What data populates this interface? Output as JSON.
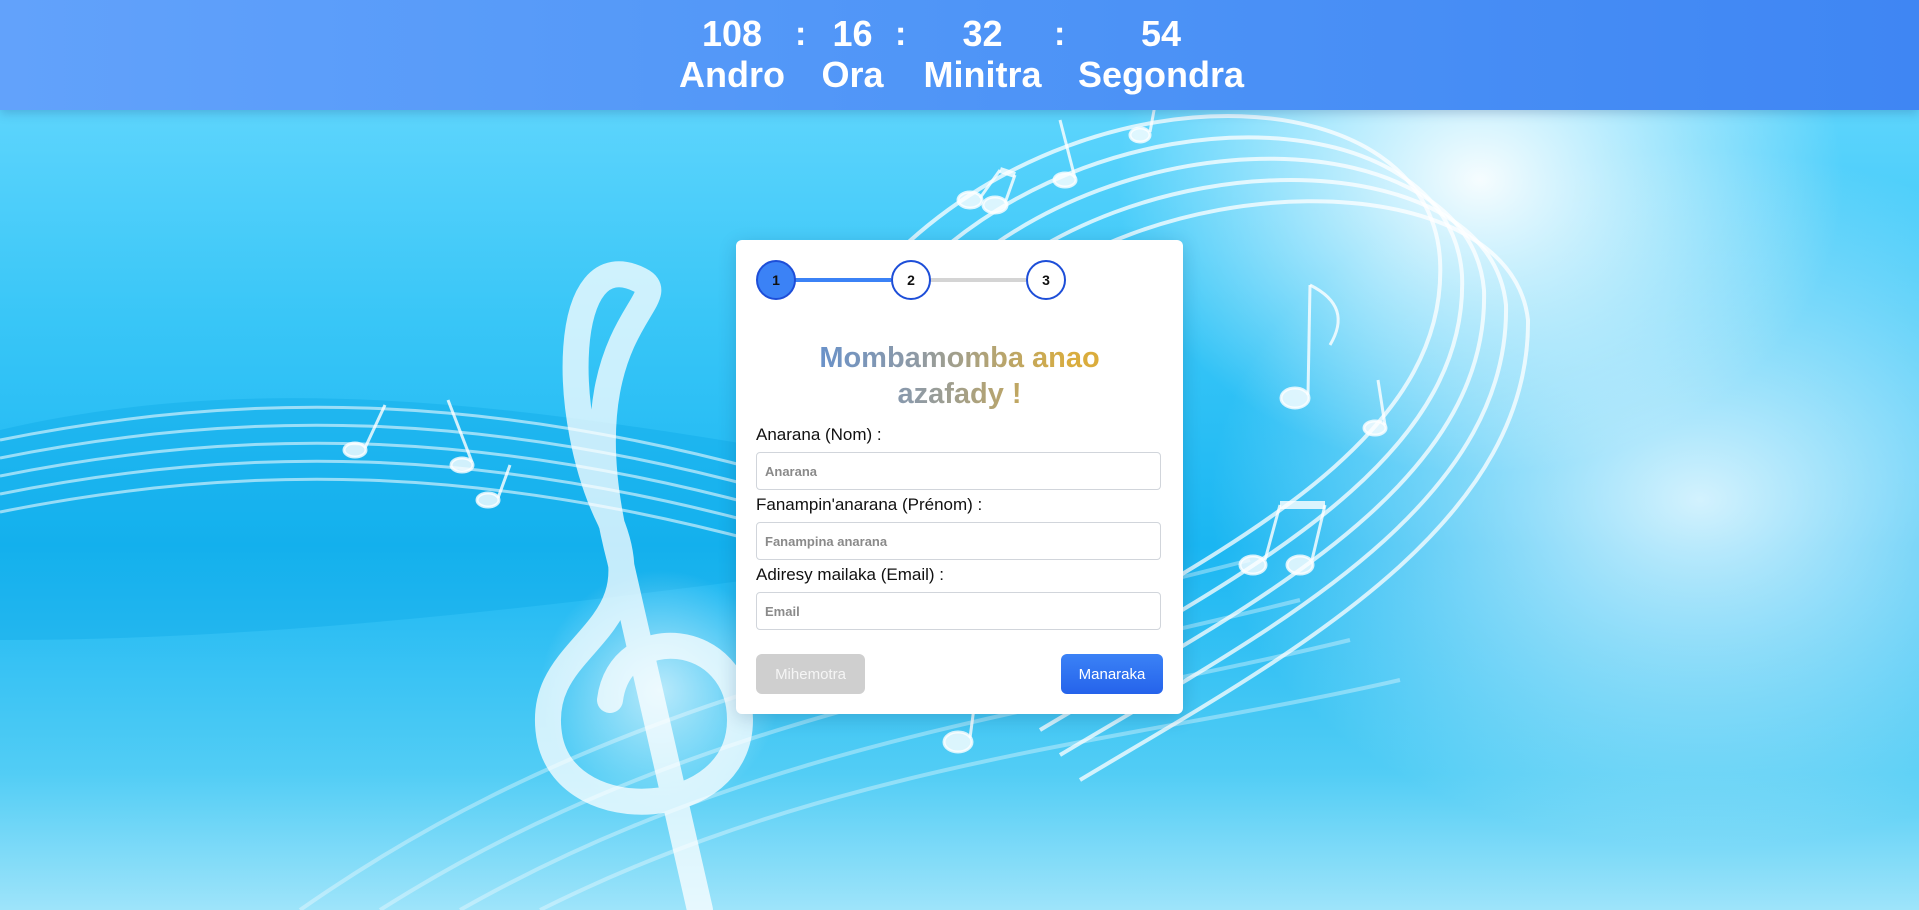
{
  "countdown": {
    "days": {
      "value": "108",
      "label": "Andro"
    },
    "hours": {
      "value": "16",
      "label": "Ora"
    },
    "minutes": {
      "value": "32",
      "label": "Minitra"
    },
    "seconds": {
      "value": "54",
      "label": "Segondra"
    },
    "separator": ":"
  },
  "stepper": {
    "steps": [
      "1",
      "2",
      "3"
    ],
    "active_step": 1
  },
  "form": {
    "title_line1": "Mombamomba anao",
    "title_line2": "azafady !",
    "fields": [
      {
        "label": "Anarana (Nom) :",
        "placeholder": "Anarana",
        "value": ""
      },
      {
        "label": "Fanampin'anarana (Prénom) :",
        "placeholder": "Fanampina anarana",
        "value": ""
      },
      {
        "label": "Adiresy mailaka (Email) :",
        "placeholder": "Email",
        "value": ""
      }
    ],
    "prev_label": "Mihemotra",
    "next_label": "Manaraka"
  },
  "colors": {
    "accent": "#3b82f6",
    "top_bar": "#4f95f7",
    "disabled_button": "#cfcfcf"
  }
}
